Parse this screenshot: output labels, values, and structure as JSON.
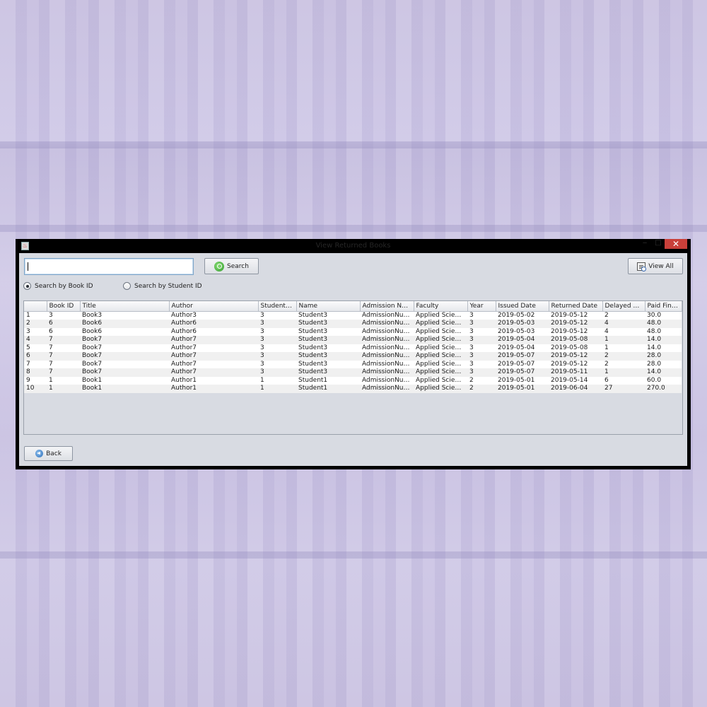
{
  "window": {
    "title": "View Returned Books",
    "close_glyph": "✕",
    "minimize_glyph": "‒",
    "maximize_glyph": "□"
  },
  "search": {
    "value": "",
    "placeholder": "",
    "button_label": "Search"
  },
  "view_all_label": "View All",
  "radios": {
    "book_id_label": "Search by Book ID",
    "book_id_selected": true,
    "student_id_label": "Search by Student ID",
    "student_id_selected": false
  },
  "table": {
    "columns": [
      "",
      "Book ID",
      "Title",
      "Author",
      "Student ID",
      "Name",
      "Admission Nu...",
      "Faculty",
      "Year",
      "Issued Date",
      "Returned Date",
      "Delayed Da...",
      "Paid Fine ..."
    ],
    "rows": [
      [
        "1",
        "3",
        "Book3",
        "Author3",
        "3",
        "Student3",
        "AdmissionNum...",
        "Applied Science",
        "3",
        "2019-05-02",
        "2019-05-12",
        "2",
        "30.0"
      ],
      [
        "2",
        "6",
        "Book6",
        "Author6",
        "3",
        "Student3",
        "AdmissionNum...",
        "Applied Science",
        "3",
        "2019-05-03",
        "2019-05-12",
        "4",
        "48.0"
      ],
      [
        "3",
        "6",
        "Book6",
        "Author6",
        "3",
        "Student3",
        "AdmissionNum...",
        "Applied Science",
        "3",
        "2019-05-03",
        "2019-05-12",
        "4",
        "48.0"
      ],
      [
        "4",
        "7",
        "Book7",
        "Author7",
        "3",
        "Student3",
        "AdmissionNum...",
        "Applied Science",
        "3",
        "2019-05-04",
        "2019-05-08",
        "1",
        "14.0"
      ],
      [
        "5",
        "7",
        "Book7",
        "Author7",
        "3",
        "Student3",
        "AdmissionNum...",
        "Applied Science",
        "3",
        "2019-05-04",
        "2019-05-08",
        "1",
        "14.0"
      ],
      [
        "6",
        "7",
        "Book7",
        "Author7",
        "3",
        "Student3",
        "AdmissionNum...",
        "Applied Science",
        "3",
        "2019-05-07",
        "2019-05-12",
        "2",
        "28.0"
      ],
      [
        "7",
        "7",
        "Book7",
        "Author7",
        "3",
        "Student3",
        "AdmissionNum...",
        "Applied Science",
        "3",
        "2019-05-07",
        "2019-05-12",
        "2",
        "28.0"
      ],
      [
        "8",
        "7",
        "Book7",
        "Author7",
        "3",
        "Student3",
        "AdmissionNum...",
        "Applied Science",
        "3",
        "2019-05-07",
        "2019-05-11",
        "1",
        "14.0"
      ],
      [
        "9",
        "1",
        "Book1",
        "Author1",
        "1",
        "Student1",
        "AdmissionNum...",
        "Applied Science",
        "2",
        "2019-05-01",
        "2019-05-14",
        "6",
        "60.0"
      ],
      [
        "10",
        "1",
        "Book1",
        "Author1",
        "1",
        "Student1",
        "AdmissionNum...",
        "Applied Science",
        "2",
        "2019-05-01",
        "2019-06-04",
        "27",
        "270.0"
      ]
    ]
  },
  "back_label": "Back",
  "icons": {
    "app": "java-app-icon",
    "search": "search-icon",
    "view_all": "view-all-icon",
    "back": "back-arrow-icon"
  },
  "colors": {
    "close_button": "#c9403a",
    "panel_bg": "#d8dbe2",
    "window_frame": "#000000"
  }
}
